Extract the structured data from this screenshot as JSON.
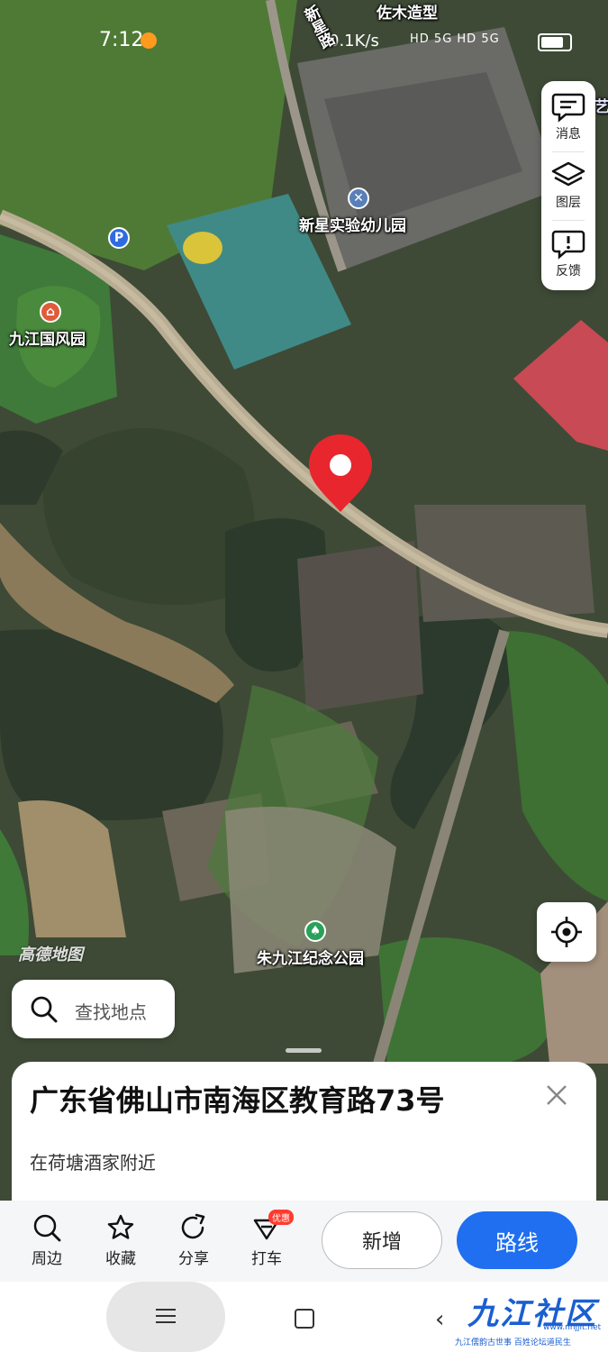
{
  "status_bar": {
    "time": "7:12",
    "network_speed": "0.1K/s",
    "signal_text": "HD 5G HD 5G"
  },
  "map": {
    "labels": {
      "road_xinxing": "新星路",
      "zuomu": "佐木造型",
      "kindergarten": "新星实验幼儿园",
      "guofengyuan": "九江国风园",
      "park": "朱九江纪念公园",
      "edge_right": "艺"
    },
    "watermark": "高德地图",
    "pin_color": "#e8262e"
  },
  "toolbar": {
    "messages_label": "消息",
    "layers_label": "图层",
    "feedback_label": "反馈"
  },
  "search": {
    "placeholder": "查找地点"
  },
  "place": {
    "address": "广东省佛山市南海区教育路73号",
    "nearby": "在荷塘酒家附近"
  },
  "actions": {
    "nearby_label": "周边",
    "favorite_label": "收藏",
    "share_label": "分享",
    "taxi_label": "打车",
    "taxi_badge": "优惠",
    "add_label": "新增",
    "route_label": "路线"
  },
  "site_watermark": {
    "name": "九江社区",
    "url": "www.nhjjlt.net",
    "slogan": "九江儒韵古世事  百姓论坛道民生"
  },
  "colors": {
    "accent": "#1f6ff0",
    "badge": "#ff3b30"
  }
}
